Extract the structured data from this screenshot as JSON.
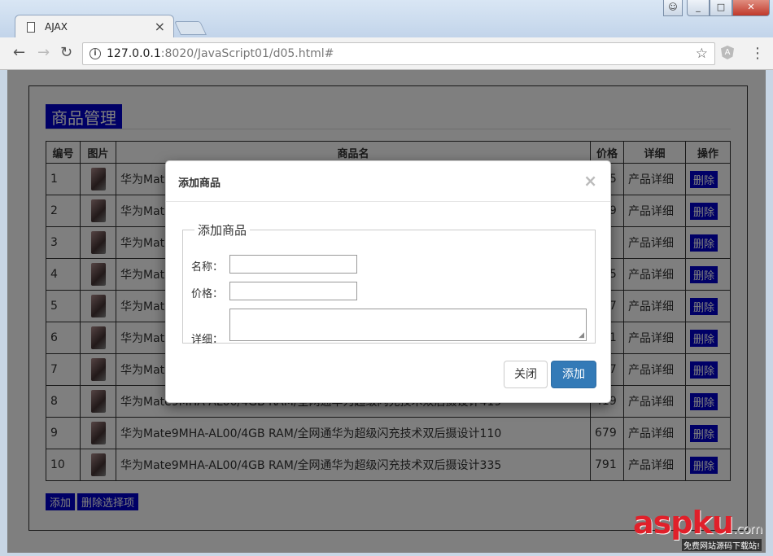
{
  "browser": {
    "tab_title": "AJAX",
    "url_host": "127.0.0.1",
    "url_rest": ":8020/JavaScript01/d05.html#"
  },
  "page": {
    "heading": "商品管理",
    "table_headers": [
      "编号",
      "图片",
      "商品名",
      "价格",
      "详细",
      "操作"
    ],
    "rows": [
      {
        "id": "1",
        "name": "华为Mate9MHA-AL00/4GB RAM/全网通华为超级闪充技术双后摄设计345",
        "price": "345",
        "detail": "产品详细",
        "action": "删除"
      },
      {
        "id": "2",
        "name": "华为Mate9MHA-AL00/4GB RAM/全网通华为超级闪充技术双后摄设计659",
        "price": "659",
        "detail": "产品详细",
        "action": "删除"
      },
      {
        "id": "3",
        "name": "华为Mate9MHA-AL00/4GB RAM/全网通华为超级闪充技术双后摄设计",
        "price": "",
        "detail": "产品详细",
        "action": "删除"
      },
      {
        "id": "4",
        "name": "华为Mate9MHA-AL00/4GB RAM/全网通华为超级闪充技术双后摄设计545",
        "price": "545",
        "detail": "产品详细",
        "action": "删除"
      },
      {
        "id": "5",
        "name": "华为Mate9MHA-AL00/4GB RAM/全网通华为超级闪充技术双后摄设计477",
        "price": "477",
        "detail": "产品详细",
        "action": "删除"
      },
      {
        "id": "6",
        "name": "华为Mate9MHA-AL00/4GB RAM/全网通华为超级闪充技术双后摄设计211",
        "price": "211",
        "detail": "产品详细",
        "action": "删除"
      },
      {
        "id": "7",
        "name": "华为Mate9MHA-AL00/4GB RAM/全网通华为超级闪充技术双后摄设计557",
        "price": "557",
        "detail": "产品详细",
        "action": "删除"
      },
      {
        "id": "8",
        "name": "华为Mate9MHA-AL00/4GB RAM/全网通华为超级闪充技术双后摄设计419",
        "price": "419",
        "detail": "产品详细",
        "action": "删除"
      },
      {
        "id": "9",
        "name": "华为Mate9MHA-AL00/4GB RAM/全网通华为超级闪充技术双后摄设计110",
        "price": "679",
        "detail": "产品详细",
        "action": "删除"
      },
      {
        "id": "10",
        "name": "华为Mate9MHA-AL00/4GB RAM/全网通华为超级闪充技术双后摄设计335",
        "price": "791",
        "detail": "产品详细",
        "action": "删除"
      }
    ],
    "add_button": "添加",
    "delete_selected_button": "删除选择项"
  },
  "modal": {
    "title": "添加商品",
    "close_glyph": "×",
    "legend": "添加商品",
    "name_label": "名称：",
    "price_label": "价格：",
    "detail_label": "详细：",
    "close_button": "关闭",
    "add_button": "添加"
  },
  "watermark": {
    "main": "aspku",
    "suffix": ".com",
    "sub": "免费网站源码下载站!"
  },
  "colors": {
    "accent_blue": "#0000cc",
    "primary_button": "#337ab7"
  }
}
